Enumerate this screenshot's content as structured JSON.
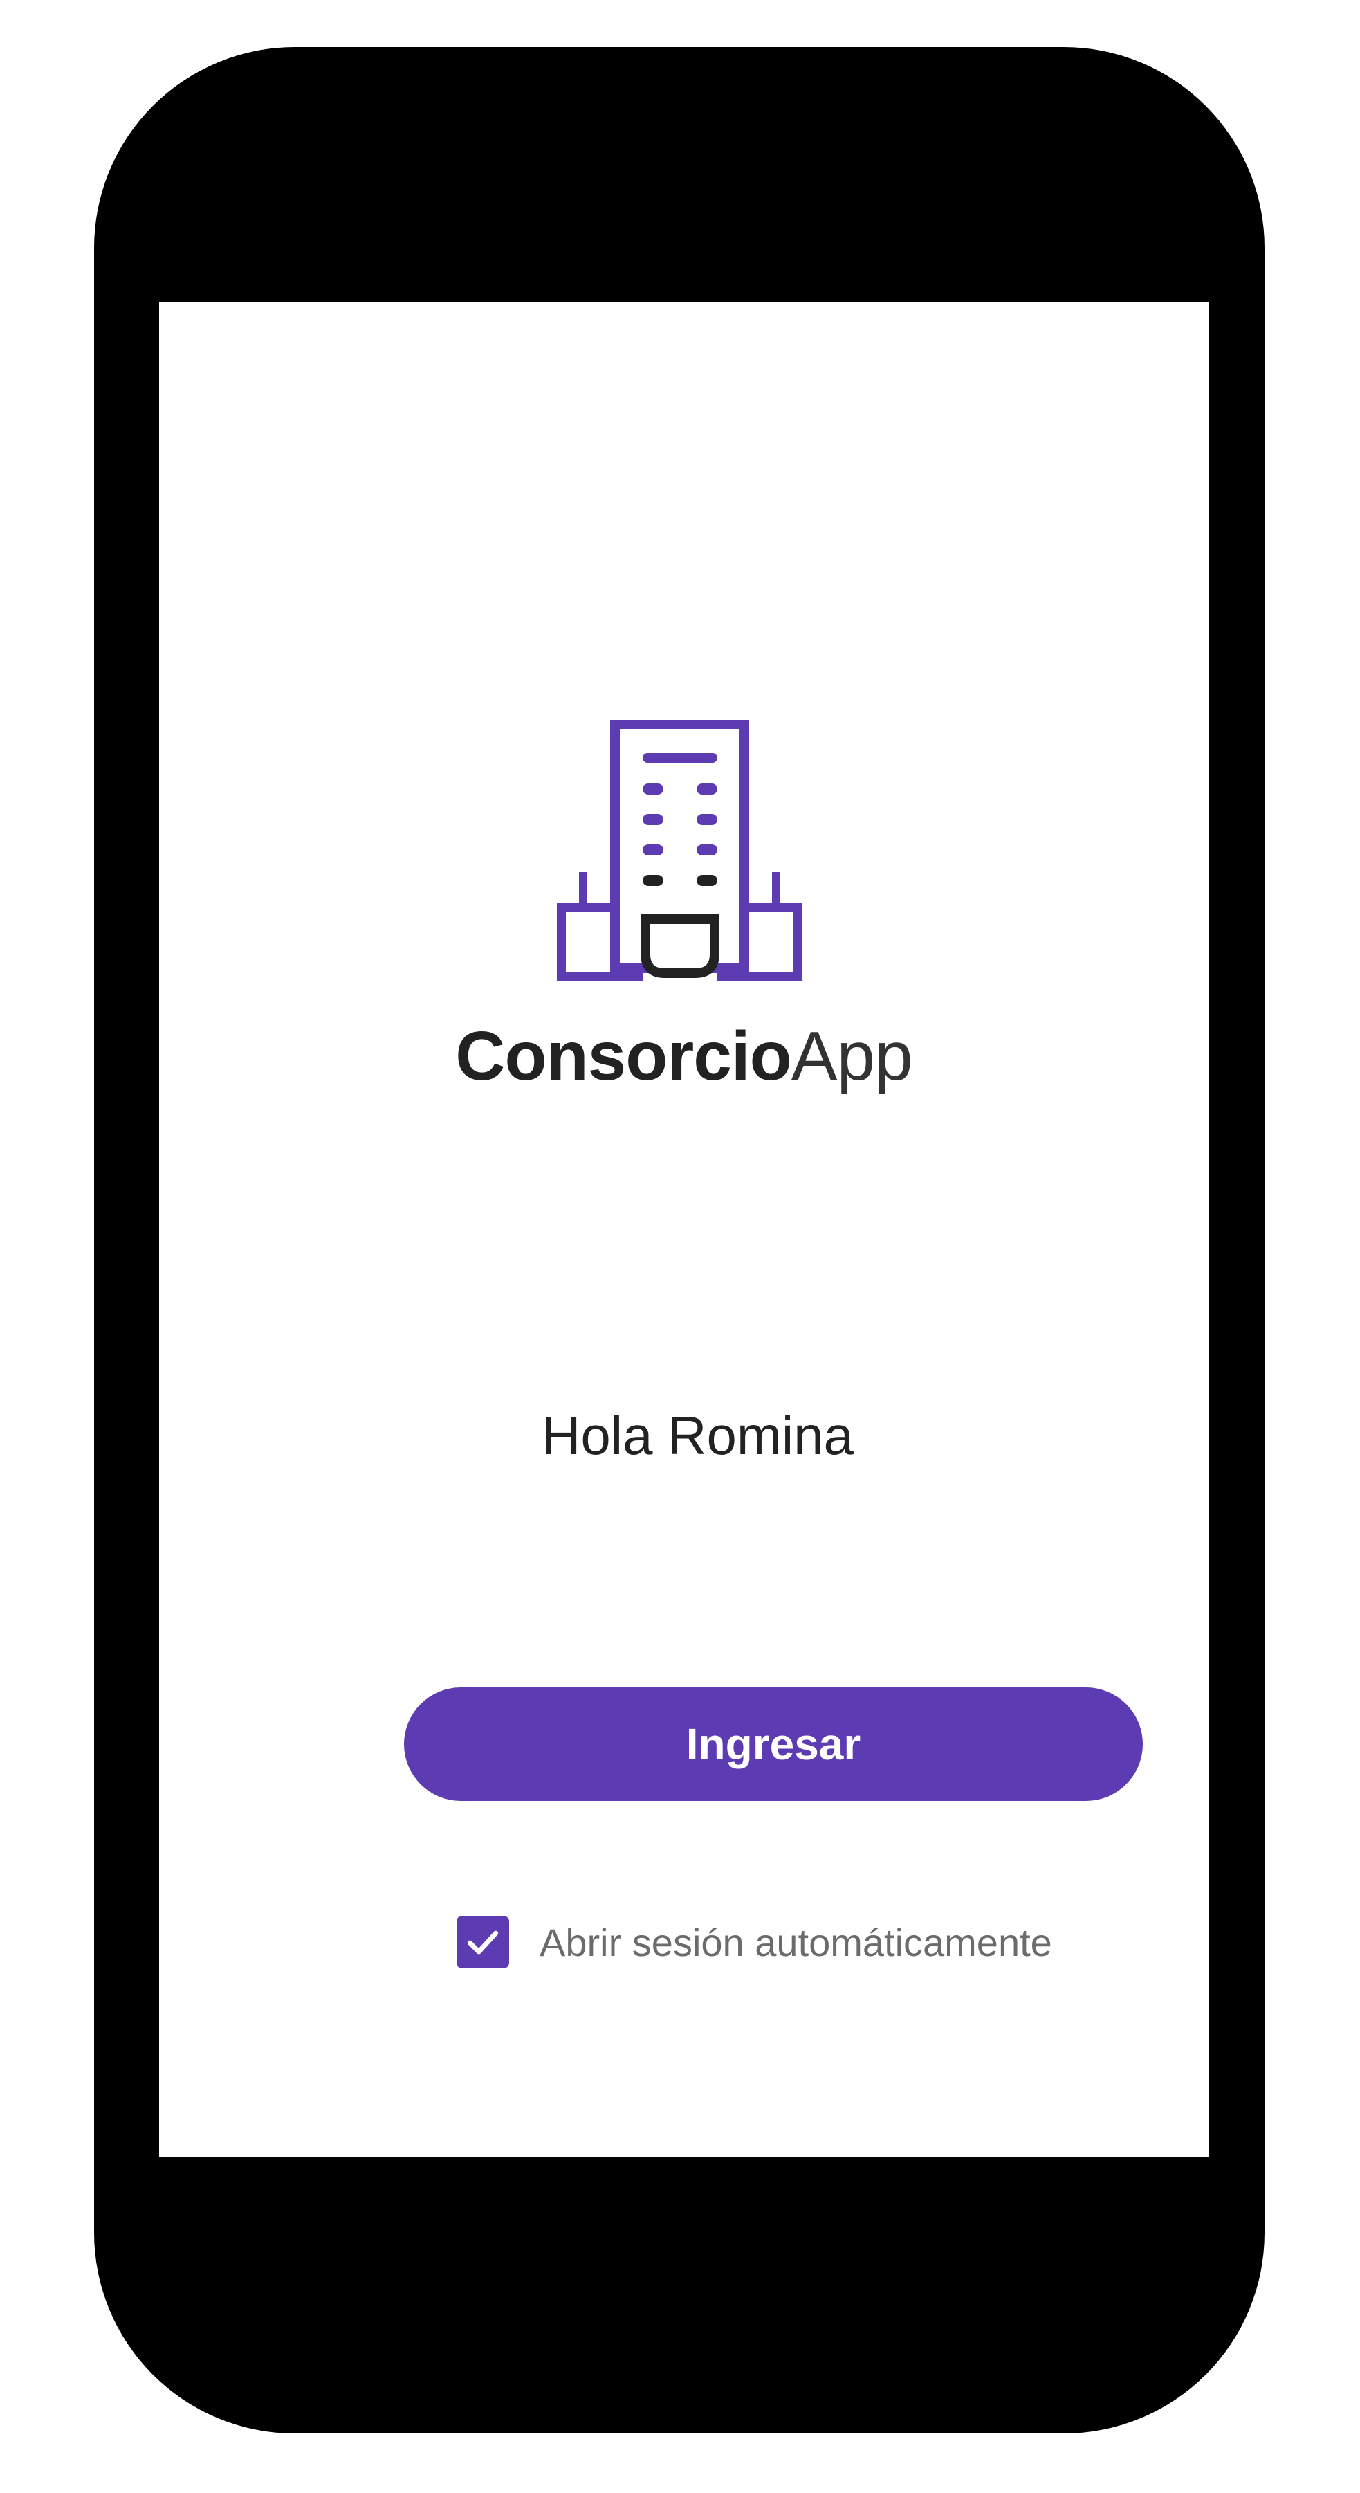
{
  "app": {
    "brand_bold": "Consorcio",
    "brand_light": "App",
    "logo_icon": "building-icon",
    "accent_color": "#5c3bb3"
  },
  "login": {
    "greeting": "Hola Romina",
    "button_label": "Ingresar",
    "auto_login_label": "Abrir sesión automáticamente",
    "auto_login_checked": true
  }
}
